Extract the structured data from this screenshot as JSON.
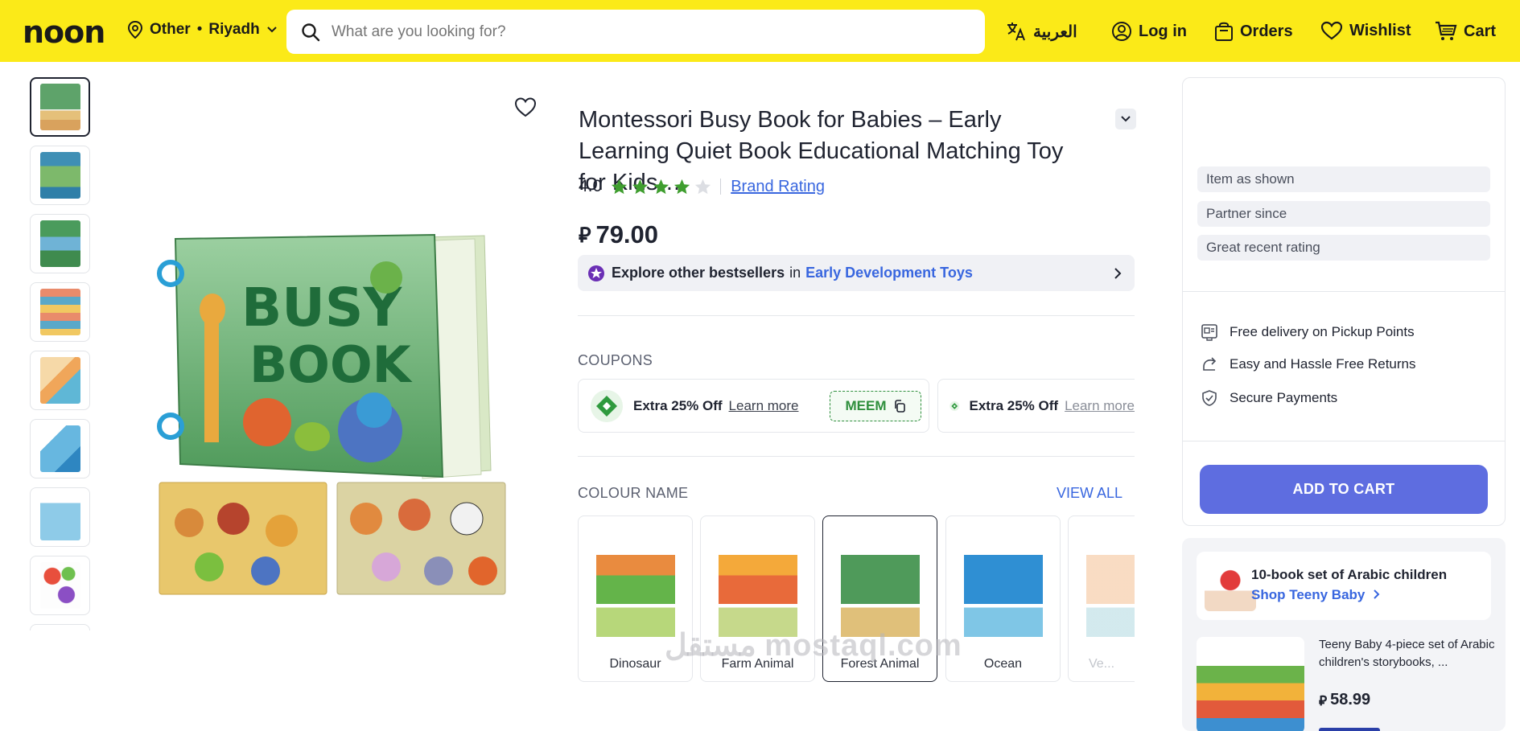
{
  "header": {
    "logo": "noon",
    "location": {
      "prefix": "Other",
      "separator": "•",
      "city": "Riyadh"
    },
    "search": {
      "placeholder": "What are you looking for?"
    },
    "nav": {
      "language": "العربية",
      "login": "Log in",
      "orders": "Orders",
      "wishlist": "Wishlist",
      "cart": "Cart"
    }
  },
  "product": {
    "title": "Montessori Busy Book for Babies – Early Learning Quiet Book Educational Matching Toy for Kids…",
    "rating": "4.0",
    "stars": 4,
    "brand_rating_label": "Brand Rating",
    "currency_symbol": "⃁",
    "price": "79.00",
    "bestsellers": {
      "text": "Explore other bestsellers",
      "in": "in",
      "category": "Early Development Toys"
    }
  },
  "coupons": {
    "section_label": "COUPONS",
    "items": [
      {
        "text": "Extra 25% Off",
        "learn": "Learn more",
        "code": "MEEM"
      },
      {
        "text": "Extra 25% Off",
        "learn": "Learn more"
      }
    ]
  },
  "colours": {
    "section_label": "COLOUR NAME",
    "view_all": "VIEW ALL",
    "options": [
      {
        "label": "Dinosaur"
      },
      {
        "label": "Farm Animal"
      },
      {
        "label": "Forest Animal",
        "selected": true
      },
      {
        "label": "Ocean"
      },
      {
        "label": "Ve..."
      }
    ]
  },
  "seller": {
    "item_as_shown": "Item as shown",
    "partner_since": "Partner since",
    "great_rating": "Great recent rating",
    "perks": [
      "Free delivery on Pickup Points",
      "Easy and Hassle Free Returns",
      "Secure Payments"
    ],
    "add_to_cart": "ADD TO CART"
  },
  "promo": {
    "title": "10-book set of Arabic children",
    "link": "Shop Teeny Baby",
    "product_title": "Teeny Baby 4-piece set of Arabic children's storybooks, ...",
    "product_price": "58.99"
  },
  "watermark": "مستقل mostaql.com",
  "colors": {
    "header_bg": "#fbea18",
    "accent_blue": "#3866df",
    "cart_button": "#5e6de0",
    "star_green": "#3f9e2f",
    "coupon_green": "#2f8f3d"
  }
}
